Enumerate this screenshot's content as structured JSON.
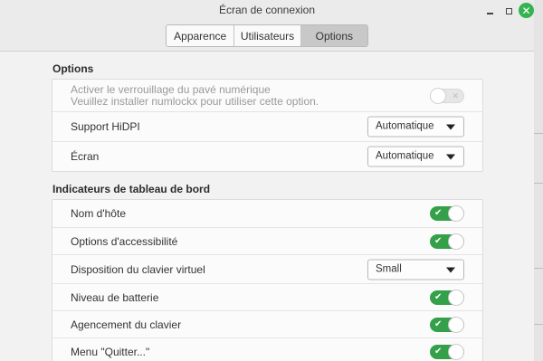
{
  "window": {
    "title": "Écran de connexion"
  },
  "tabs": [
    {
      "label": "Apparence",
      "active": false
    },
    {
      "label": "Utilisateurs",
      "active": false
    },
    {
      "label": "Options",
      "active": true
    }
  ],
  "options_section": {
    "title": "Options",
    "numlock": {
      "label_line1": "Activer le verrouillage du pavé numérique",
      "label_line2": "Veuillez installer numlockx pour utiliser cette option.",
      "enabled": false,
      "disabled": true
    },
    "hidpi": {
      "label": "Support HiDPI",
      "value": "Automatique"
    },
    "screen": {
      "label": "Écran",
      "value": "Automatique"
    }
  },
  "indicators_section": {
    "title": "Indicateurs de tableau de bord",
    "hostname": {
      "label": "Nom d'hôte",
      "enabled": true
    },
    "accessibility": {
      "label": "Options d'accessibilité",
      "enabled": true
    },
    "virtual_keyboard": {
      "label": "Disposition du clavier virtuel",
      "value": "Small"
    },
    "battery": {
      "label": "Niveau de batterie",
      "enabled": true
    },
    "keyboard_layout": {
      "label": "Agencement du clavier",
      "enabled": true
    },
    "quit_menu": {
      "label": "Menu \"Quitter...\"",
      "enabled": true
    }
  },
  "colors": {
    "accent": "#35a04a",
    "close_button": "#35b351"
  },
  "icons": {
    "switch_on": "check-icon",
    "switch_off": "x-icon",
    "dropdown": "caret-down-icon"
  }
}
